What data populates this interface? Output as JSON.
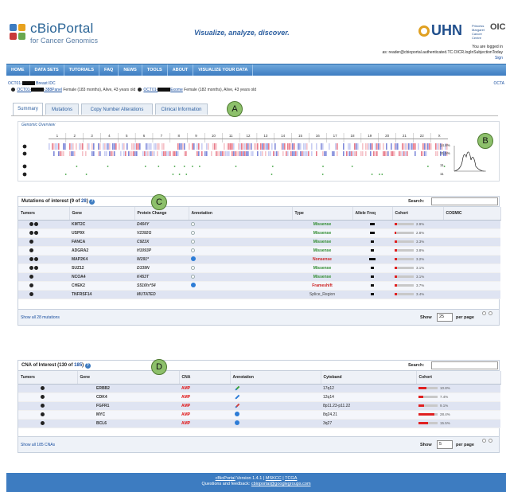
{
  "header": {
    "logo_title": "cBioPortal",
    "logo_subtitle": "for Cancer Genomics",
    "tagline": "Visualize, analyze, discover.",
    "institution": "UHN",
    "pm_text": "Princess Margaret Cancer Centre",
    "oicr": "OIC",
    "login_line1": "You are logged in",
    "login_line2": "as: reader@cbioportal.authenticated.TC.OICR.logInSubjectionToday",
    "signout": "Sign"
  },
  "nav": [
    "HOME",
    "DATA SETS",
    "TUTORIALS",
    "FAQ",
    "NEWS",
    "TOOLS",
    "ABOUT",
    "VISUALIZE YOUR DATA"
  ],
  "patient": {
    "id_prefix": "OCT01-",
    "study": "Breast IDC",
    "right_label": "OCTA",
    "sample1_prefix": "OCT01-",
    "sample1_suffix": "-388Panel",
    "sample1_info": "Female (183 months), Alive, 43 years old",
    "sample2_prefix": "OCT01-",
    "sample2_suffix": "Exome",
    "sample2_info": "Female (182 months), Alive, 43 years old"
  },
  "tabs": [
    "Summary",
    "Mutations",
    "Copy Number Alterations",
    "Clinical Information"
  ],
  "callouts": {
    "a": "A",
    "b": "B",
    "c": "C",
    "d": "D"
  },
  "overview": {
    "title": "Genomic Overview",
    "chromosomes": [
      "1",
      "2",
      "3",
      "4",
      "5",
      "6",
      "7",
      "8",
      "9",
      "10",
      "11",
      "12",
      "13",
      "14",
      "15",
      "16",
      "17",
      "18",
      "19",
      "20",
      "21",
      "22",
      "X"
    ],
    "right_stats": [
      "14.8%",
      "31.5%",
      "11",
      "11"
    ]
  },
  "mutations": {
    "title": "Mutations of interest",
    "count_shown": "9",
    "count_total": "28",
    "search_label": "Search:",
    "columns": [
      "Tumors",
      "Gene",
      "Protein Change",
      "Annotation",
      "Type",
      "Allele Freq",
      "Cohort",
      "COSMIC"
    ],
    "rows": [
      {
        "tumors": 2,
        "gene": "KMT2C",
        "protein": "D464Y",
        "anno": "empty",
        "type": "Missense",
        "tclass": "missense",
        "freq": 0.55,
        "cohort": "2.9%",
        "cohort_val": 0.12
      },
      {
        "tumors": 2,
        "gene": "USP9X",
        "protein": "V2392G",
        "anno": "empty",
        "type": "Missense",
        "tclass": "missense",
        "freq": 0.45,
        "cohort": "2.8%",
        "cohort_val": 0.1
      },
      {
        "tumors": 1,
        "gene": "FANCA",
        "protein": "C923X",
        "anno": "empty",
        "type": "Missense",
        "tclass": "missense",
        "freq": 0.35,
        "cohort": "3.3%",
        "cohort_val": 0.12
      },
      {
        "tumors": 1,
        "gene": "ADGRA2",
        "protein": "H1093P",
        "anno": "empty",
        "type": "Missense",
        "tclass": "missense",
        "freq": 0.35,
        "cohort": "3.8%",
        "cohort_val": 0.13
      },
      {
        "tumors": 2,
        "gene": "MAP2K4",
        "protein": "W291*",
        "anno": "full",
        "type": "Nonsense",
        "tclass": "nonsense",
        "freq": 0.6,
        "cohort": "3.2%",
        "cohort_val": 0.12
      },
      {
        "tumors": 2,
        "gene": "SUZ12",
        "protein": "D339N",
        "anno": "empty",
        "type": "Missense",
        "tclass": "missense",
        "freq": 0.3,
        "cohort": "3.1%",
        "cohort_val": 0.11
      },
      {
        "tumors": 1,
        "gene": "NCOA4",
        "protein": "K453T",
        "anno": "empty",
        "type": "Missense",
        "tclass": "missense",
        "freq": 0.3,
        "cohort": "3.1%",
        "cohort_val": 0.11
      },
      {
        "tumors": 1,
        "gene": "CHEK2",
        "protein": "S516fs*54",
        "anno": "full",
        "type": "Frameshift",
        "tclass": "frameshift",
        "freq": 0.3,
        "cohort": "3.7%",
        "cohort_val": 0.13
      },
      {
        "tumors": 1,
        "gene": "TNFRSF14",
        "protein": "MUTATED",
        "anno": "none",
        "type": "Splice_Region",
        "tclass": "splice",
        "freq": 0.3,
        "cohort": "3.4%",
        "cohort_val": 0.12
      }
    ],
    "show_all": "Show all 28 mutations",
    "show_label": "Show",
    "per_page": "25",
    "per_page_label": "per page"
  },
  "cna": {
    "title": "CNA of Interest",
    "count_shown": "130",
    "count_total": "185",
    "search_label": "Search:",
    "columns": [
      "Tumors",
      "Gene",
      "CNA",
      "Annotation",
      "Cytoband",
      "Cohort"
    ],
    "rows": [
      {
        "gene": "ERBB2",
        "cna": "AMP",
        "anno": "edit-green",
        "cytoband": "17q12",
        "cohort": "10.8%",
        "cohort_val": 0.4
      },
      {
        "gene": "CDK4",
        "cna": "AMP",
        "anno": "edit",
        "cytoband": "12q14",
        "cohort": "7.4%",
        "cohort_val": 0.25
      },
      {
        "gene": "FGFR1",
        "cna": "AMP",
        "anno": "edit-red",
        "cytoband": "8p11.23-p11.22",
        "cohort": "9.1%",
        "cohort_val": 0.3
      },
      {
        "gene": "MYC",
        "cna": "AMP",
        "anno": "full",
        "cytoband": "8q24.21",
        "cohort": "28.4%",
        "cohort_val": 0.85
      },
      {
        "gene": "BCL6",
        "cna": "AMP",
        "anno": "full",
        "cytoband": "3q27",
        "cohort": "15.5%",
        "cohort_val": 0.5
      }
    ],
    "show_all": "Show all 185 CNAs",
    "show_label": "Show",
    "per_page": "5",
    "per_page_label": "per page"
  },
  "footer": {
    "line1_link": "cBioPortal",
    "line1_text": "Version 1.4.1 |",
    "line1_mskcc": "MSKCC",
    "line1_sep": "|",
    "line1_tcga": "TCGA",
    "line2_text": "Questions and feedback:",
    "line2_email": "cbioportal@googlegroups.com"
  },
  "colors": {
    "nav": "#3d7cc1",
    "callout": "#8dc06b",
    "amp": "#e01010",
    "missense": "#2e8b2e"
  }
}
